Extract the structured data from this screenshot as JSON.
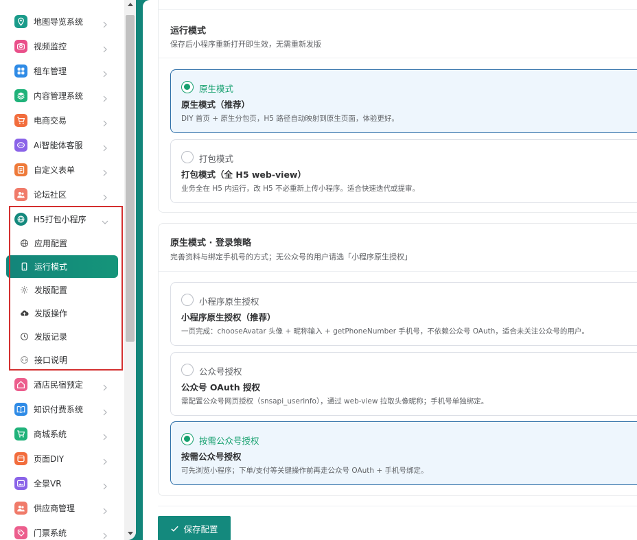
{
  "sidebar": {
    "items": [
      {
        "label": "地图导览系统",
        "icon": "map-pin-icon",
        "color": "#1a9b8a"
      },
      {
        "label": "视频监控",
        "icon": "camera-icon",
        "color": "#e9508a"
      },
      {
        "label": "租车管理",
        "icon": "car-icon",
        "color": "#2f8be6"
      },
      {
        "label": "内容管理系统",
        "icon": "layers-icon",
        "color": "#20b27a"
      },
      {
        "label": "电商交易",
        "icon": "cart-icon",
        "color": "#f26d3d"
      },
      {
        "label": "Ai智能体客服",
        "icon": "ai-icon",
        "color": "#8a63e8"
      },
      {
        "label": "自定义表单",
        "icon": "form-icon",
        "color": "#ee7a3a"
      },
      {
        "label": "论坛社区",
        "icon": "users-icon",
        "color": "#f07b6a"
      },
      {
        "label": "H5打包小程序",
        "icon": "globe-icon",
        "color": "#14897d"
      },
      {
        "label": "酒店民宿预定",
        "icon": "home-icon",
        "color": "#ec5e8d"
      },
      {
        "label": "知识付费系统",
        "icon": "book-icon",
        "color": "#2f8be6"
      },
      {
        "label": "商城系统",
        "icon": "shop-cart-icon",
        "color": "#20b27a"
      },
      {
        "label": "页面DIY",
        "icon": "page-icon",
        "color": "#f26d3d"
      },
      {
        "label": "全景VR",
        "icon": "image-icon",
        "color": "#8a63e8"
      },
      {
        "label": "供应商管理",
        "icon": "supplier-icon",
        "color": "#f07b6a"
      },
      {
        "label": "门票系统",
        "icon": "ticket-icon",
        "color": "#ec5e8d"
      }
    ],
    "subitems": [
      {
        "label": "应用配置",
        "icon": "globe-icon"
      },
      {
        "label": "运行模式",
        "icon": "phone-icon"
      },
      {
        "label": "发版配置",
        "icon": "gear-icon"
      },
      {
        "label": "发版操作",
        "icon": "cloud-upload-icon"
      },
      {
        "label": "发版记录",
        "icon": "clock-icon"
      },
      {
        "label": "接口说明",
        "icon": "code-icon"
      }
    ]
  },
  "run_mode": {
    "title": "运行模式",
    "desc": "保存后小程序重新打开即生效，无需重新发版",
    "options": [
      {
        "radio_label": "原生模式",
        "title": "原生模式（推荐）",
        "desc": "DIY 首页 + 原生分包页，H5 路径自动映射到原生页面，体验更好。",
        "selected": true
      },
      {
        "radio_label": "打包模式",
        "title": "打包模式（全 H5 web-view）",
        "desc": "业务全在 H5 内运行，改 H5 不必重新上传小程序。适合快速迭代或提审。",
        "selected": false
      }
    ]
  },
  "login": {
    "title": "原生模式 · 登录策略",
    "desc": "完善资料与绑定手机号的方式；无公众号的用户请选「小程序原生授权」",
    "options": [
      {
        "radio_label": "小程序原生授权",
        "title": "小程序原生授权（推荐）",
        "desc": "一页完成：chooseAvatar 头像 + 昵称输入 + getPhoneNumber 手机号，不依赖公众号 OAuth，适合未关注公众号的用户。",
        "selected": false
      },
      {
        "radio_label": "公众号授权",
        "title": "公众号 OAuth 授权",
        "desc": "需配置公众号网页授权（snsapi_userinfo），通过 web-view 拉取头像昵称；手机号单独绑定。",
        "selected": false
      },
      {
        "radio_label": "按需公众号授权",
        "title": "按需公众号授权",
        "desc": "可先浏览小程序；下单/支付等关键操作前再走公众号 OAuth + 手机号绑定。",
        "selected": true
      }
    ]
  },
  "save_label": "保存配置",
  "colors": {
    "accent": "#14897d",
    "selected_radio": "#15a06e",
    "highlight_border": "#d32f2f"
  }
}
